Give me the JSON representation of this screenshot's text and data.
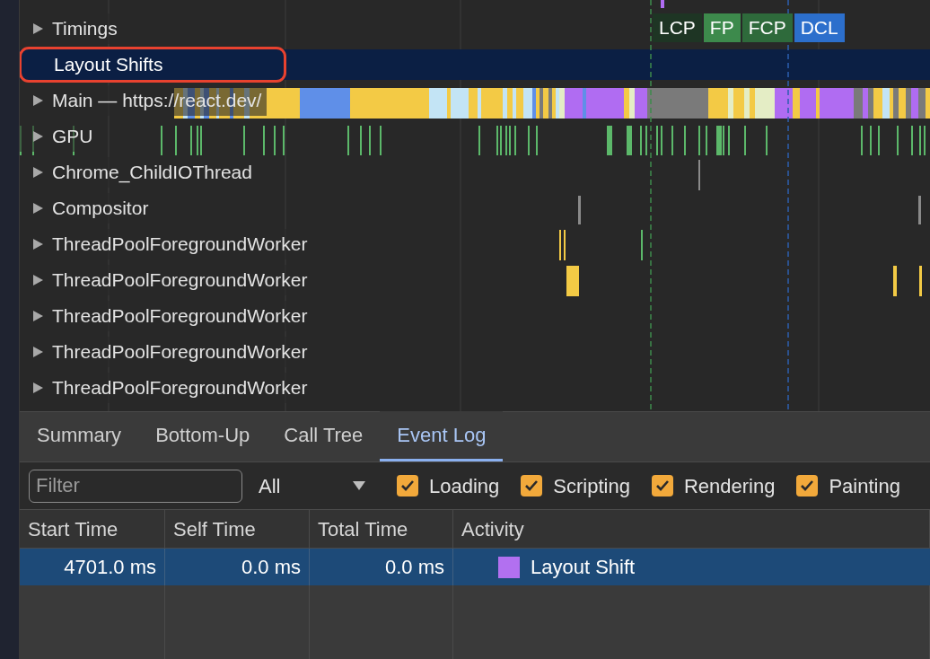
{
  "tracks": [
    {
      "label": "Timings",
      "expandable": true,
      "selected": false,
      "highlighted": false,
      "kind": "timings"
    },
    {
      "label": "Layout Shifts",
      "expandable": false,
      "selected": true,
      "highlighted": true,
      "kind": "shifts"
    },
    {
      "label": "Main — https://react.dev/",
      "expandable": true,
      "selected": false,
      "highlighted": false,
      "kind": "main"
    },
    {
      "label": "GPU",
      "expandable": true,
      "selected": false,
      "highlighted": false,
      "kind": "gpu"
    },
    {
      "label": "Chrome_ChildIOThread",
      "expandable": true,
      "selected": false,
      "highlighted": false,
      "kind": "io"
    },
    {
      "label": "Compositor",
      "expandable": true,
      "selected": false,
      "highlighted": false,
      "kind": "compositor"
    },
    {
      "label": "ThreadPoolForegroundWorker",
      "expandable": true,
      "selected": false,
      "highlighted": false,
      "kind": "worker1"
    },
    {
      "label": "ThreadPoolForegroundWorker",
      "expandable": true,
      "selected": false,
      "highlighted": false,
      "kind": "worker2"
    },
    {
      "label": "ThreadPoolForegroundWorker",
      "expandable": true,
      "selected": false,
      "highlighted": false,
      "kind": "empty"
    },
    {
      "label": "ThreadPoolForegroundWorker",
      "expandable": true,
      "selected": false,
      "highlighted": false,
      "kind": "empty"
    },
    {
      "label": "ThreadPoolForegroundWorker",
      "expandable": true,
      "selected": false,
      "highlighted": false,
      "kind": "empty"
    }
  ],
  "timing_markers": [
    {
      "label": "LCP",
      "color": "#1e3524"
    },
    {
      "label": "FP",
      "color": "#3d8a4c"
    },
    {
      "label": "FCP",
      "color": "#2e6a3b"
    },
    {
      "label": "DCL",
      "color": "#2c6fcc"
    }
  ],
  "tabs": [
    {
      "label": "Summary",
      "selected": false
    },
    {
      "label": "Bottom-Up",
      "selected": false
    },
    {
      "label": "Call Tree",
      "selected": false
    },
    {
      "label": "Event Log",
      "selected": true
    }
  ],
  "filter": {
    "placeholder": "Filter"
  },
  "duration_select": {
    "value": "All"
  },
  "categories": [
    {
      "label": "Loading",
      "checked": true
    },
    {
      "label": "Scripting",
      "checked": true
    },
    {
      "label": "Rendering",
      "checked": true
    },
    {
      "label": "Painting",
      "checked": true
    }
  ],
  "table": {
    "columns": [
      "Start Time",
      "Self Time",
      "Total Time",
      "Activity"
    ],
    "rows": [
      {
        "start_time": "4701.0 ms",
        "self_time": "0.0 ms",
        "total_time": "0.0 ms",
        "activity": "Layout Shift",
        "color": "#b270f0",
        "selected": true
      }
    ]
  }
}
